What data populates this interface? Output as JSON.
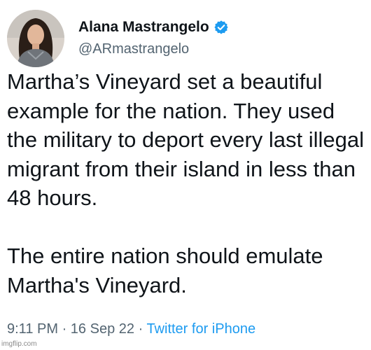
{
  "author": {
    "display_name": "Alana Mastrangelo",
    "handle": "@ARmastrangelo",
    "verified": true
  },
  "tweet": {
    "paragraphs": [
      "Martha’s Vineyard set a beautiful example for the nation. They used the military to deport every last illegal migrant from their island in less than 48 hours.",
      "The entire nation should emulate Martha's Vineyard."
    ],
    "time": "9:11 PM",
    "separator": "·",
    "date": "16 Sep 22",
    "source": "Twitter for iPhone"
  },
  "watermark": "imgflip.com",
  "colors": {
    "text": "#0f1419",
    "secondary_text": "#536471",
    "link": "#1d9bf0",
    "verified_badge": "#1d9bf0"
  },
  "icons": {
    "verified": "verified-badge-icon",
    "avatar": "profile-photo"
  }
}
